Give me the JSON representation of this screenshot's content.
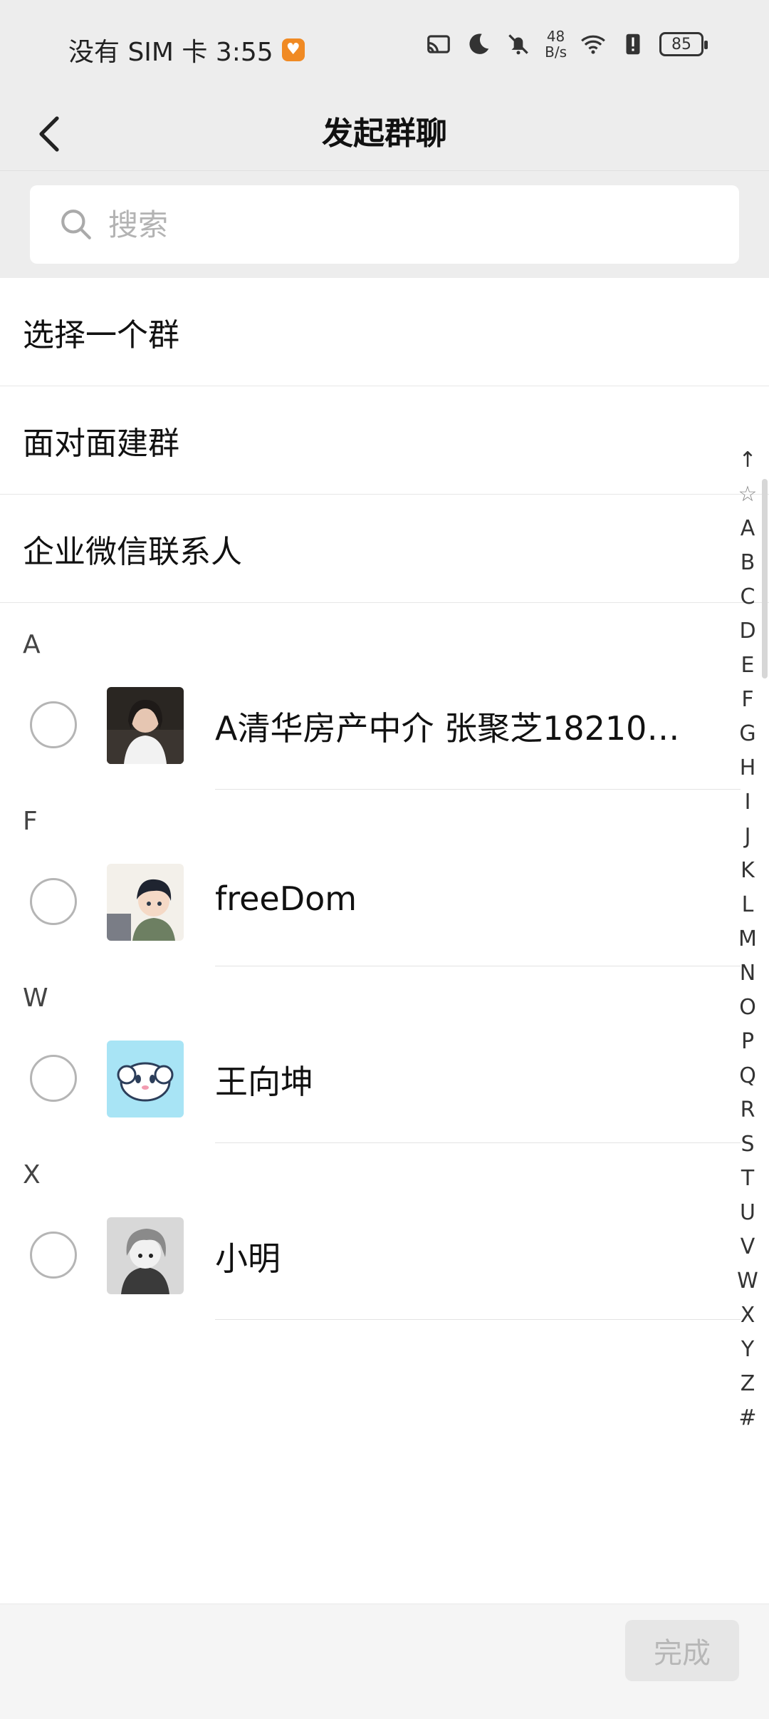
{
  "status_bar": {
    "carrier_time": "没有 SIM 卡 3:55",
    "net_speed_value": "48",
    "net_speed_unit": "B/s",
    "battery": "85",
    "icons": [
      "cast-icon",
      "moon-icon",
      "bell-off-icon",
      "wifi-icon",
      "alert-icon"
    ]
  },
  "header": {
    "title": "发起群聊"
  },
  "search": {
    "placeholder": "搜索"
  },
  "options": [
    {
      "label": "选择一个群"
    },
    {
      "label": "面对面建群"
    },
    {
      "label": "企业微信联系人"
    }
  ],
  "sections": [
    {
      "letter": "A",
      "contacts": [
        {
          "name": "A清华房产中介 张聚芝182102..."
        }
      ]
    },
    {
      "letter": "F",
      "contacts": [
        {
          "name": "freeDom"
        }
      ]
    },
    {
      "letter": "W",
      "contacts": [
        {
          "name": "王向坤"
        }
      ]
    },
    {
      "letter": "X",
      "contacts": [
        {
          "name": "小明"
        }
      ]
    }
  ],
  "index_bar": [
    "↑",
    "☆",
    "A",
    "B",
    "C",
    "D",
    "E",
    "F",
    "G",
    "H",
    "I",
    "J",
    "K",
    "L",
    "M",
    "N",
    "O",
    "P",
    "Q",
    "R",
    "S",
    "T",
    "U",
    "V",
    "W",
    "X",
    "Y",
    "Z",
    "#"
  ],
  "footer": {
    "done_label": "完成"
  },
  "colors": {
    "header_bg": "#ededed",
    "disabled_button_bg": "#e6e6e6",
    "disabled_button_text": "#b7b7b7"
  }
}
